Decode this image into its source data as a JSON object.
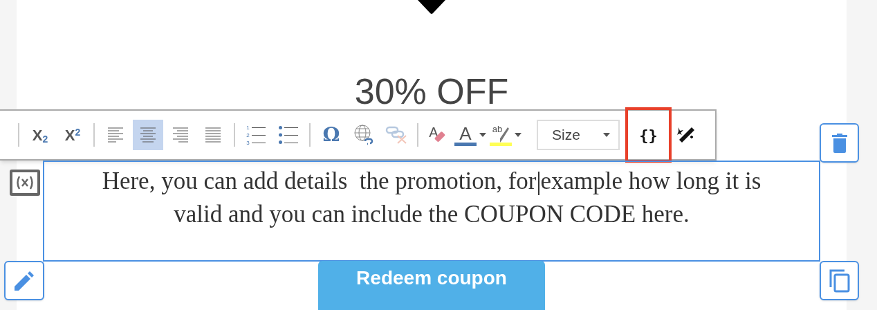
{
  "heading": "30% OFF",
  "toolbar": {
    "groups": [
      [
        {
          "kind": "script",
          "label": "X$_{2}$"
        },
        {
          "kind": "script",
          "label": "X$^{2}$"
        }
      ],
      [
        {
          "kind": "align",
          "selected": false
        },
        {
          "kind": "align",
          "selected": true
        },
        {
          "kind": "align",
          "selected": false
        },
        {
          "kind": "align",
          "selected": false
        }
      ],
      [
        {
          "kind": "numbered-list",
          "label": "1 2 3"
        },
        {
          "kind": "bulleted-list"
        }
      ],
      [
        {
          "kind": "char",
          "label": "Ω"
        },
        {
          "kind": "link"
        },
        {
          "kind": "unlink",
          "disabled": true
        }
      ],
      [
        {
          "kind": "eraser",
          "label": "A"
        },
        {
          "kind": "text-color",
          "label": "A",
          "color": "#4a78b0"
        },
        {
          "kind": "highlight",
          "label": "ab",
          "color": "#ffff55"
        },
        {
          "kind": "dropdown",
          "label": "Size"
        },
        {
          "kind": "braces",
          "label": "{}",
          "highlighted": true
        },
        {
          "kind": "wand"
        }
      ]
    ]
  },
  "text_block": {
    "text": "Here, you can add details  the promotion, for",
    "text_after_caret": "example how long it is valid and you can include the COUPON CODE here."
  },
  "button": {
    "label": "Redeem coupon"
  }
}
